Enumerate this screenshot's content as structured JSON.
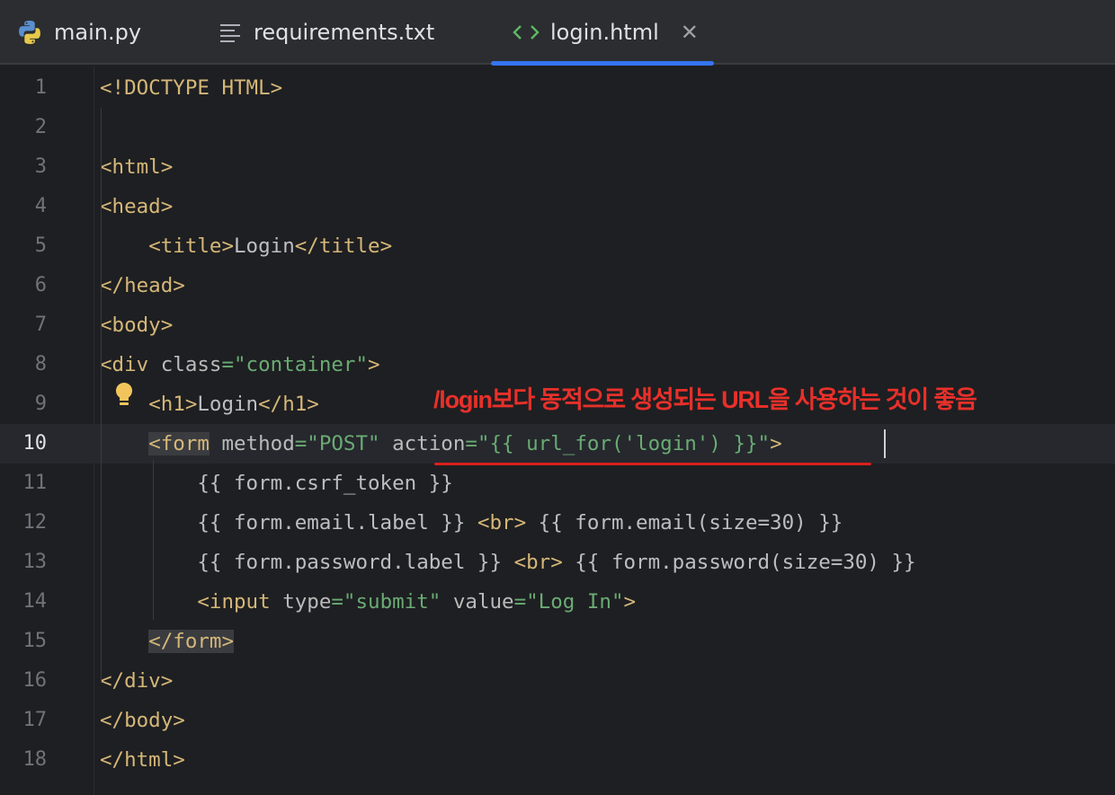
{
  "tabs": [
    {
      "label": "main.py",
      "icon": "python-icon"
    },
    {
      "label": "requirements.txt",
      "icon": "text-file-icon"
    },
    {
      "label": "login.html",
      "icon": "html-icon",
      "active": true
    }
  ],
  "editor": {
    "line_numbers": [
      "1",
      "2",
      "3",
      "4",
      "5",
      "6",
      "7",
      "8",
      "9",
      "10",
      "11",
      "12",
      "13",
      "14",
      "15",
      "16",
      "17",
      "18"
    ],
    "current_line": 10,
    "lines": [
      "<!DOCTYPE HTML>",
      "",
      "<html>",
      "<head>",
      "    <title>Login</title>",
      "</head>",
      "<body>",
      "<div class=\"container\">",
      "    <h1>Login</h1>",
      "    <form method=\"POST\" action=\"{{ url_for('login') }}\">",
      "        {{ form.csrf_token }}",
      "        {{ form.email.label }} <br> {{ form.email(size=30) }}",
      "        {{ form.password.label }} <br> {{ form.password(size=30) }}",
      "        <input type=\"submit\" value=\"Log In\">",
      "    </form>",
      "</div>",
      "</body>",
      "</html>"
    ]
  },
  "annotation": {
    "text": "/login보다 동적으로 생성되는 URL을 사용하는 것이 좋음"
  },
  "colors": {
    "background": "#1e1f22",
    "tag": "#d5b778",
    "string": "#6aab73",
    "attribute": "#bababa",
    "annotation_red": "#e8302a",
    "active_tab_underline": "#3574f0"
  }
}
